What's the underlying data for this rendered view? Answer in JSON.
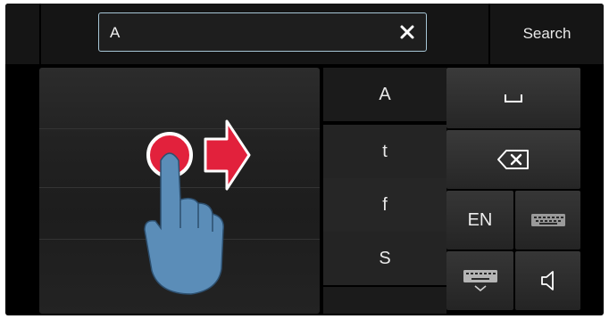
{
  "search": {
    "value": "A",
    "button_label": "Search"
  },
  "suggestions": [
    "A",
    "t",
    "f",
    "S"
  ],
  "keys": {
    "language_label": "EN"
  },
  "colors": {
    "field_border": "#a7c6d6",
    "gesture_red": "#e2213c",
    "finger_blue": "#5b8db8"
  },
  "icons": [
    "close-icon",
    "space-icon",
    "backspace-icon",
    "keyboard-icon",
    "hide-keyboard-icon",
    "speaker-icon",
    "swipe-right-gesture-icon"
  ]
}
